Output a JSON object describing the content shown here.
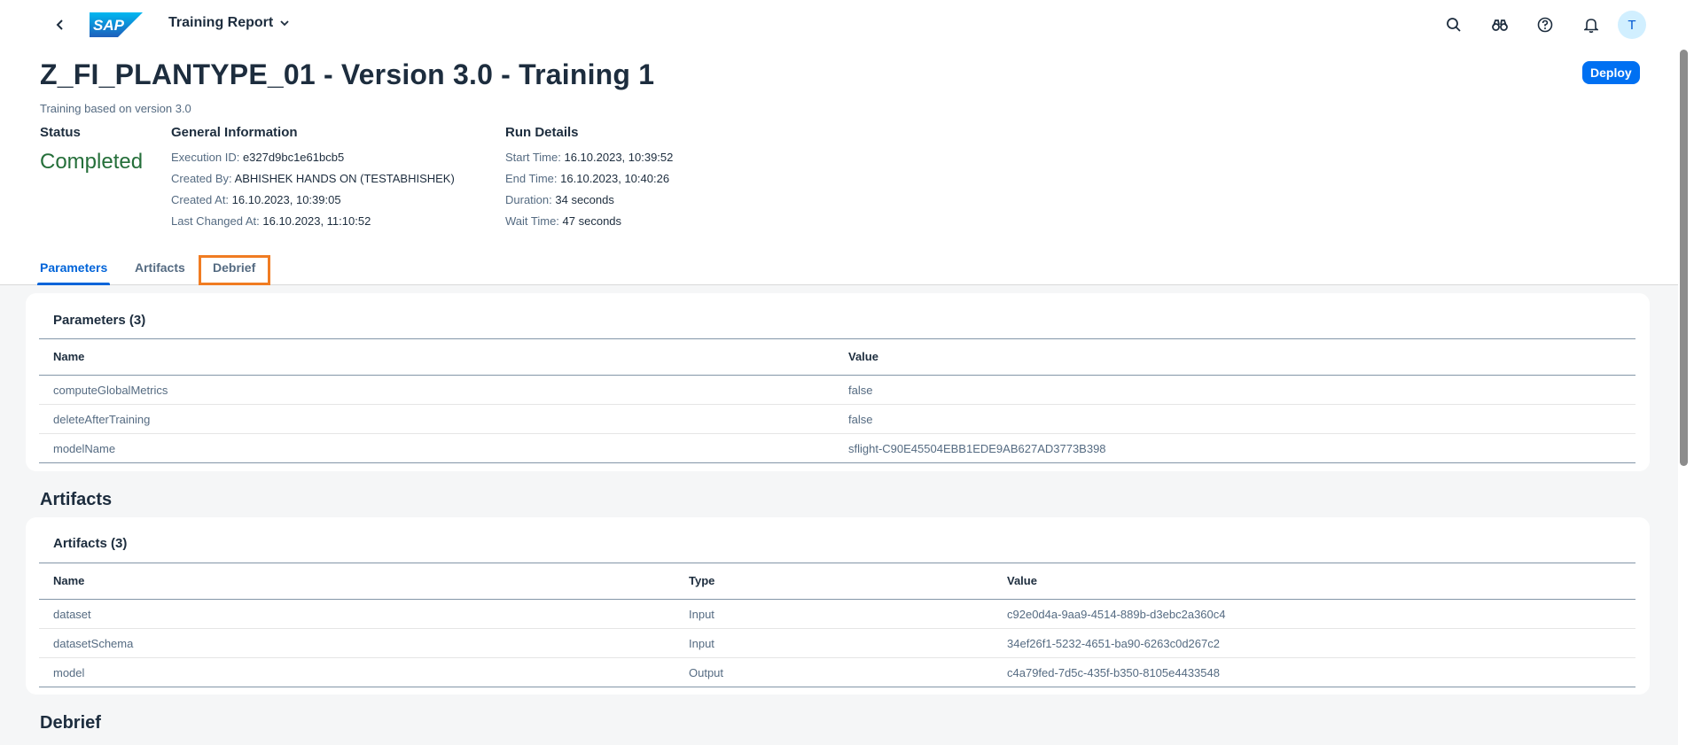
{
  "shell": {
    "app_title": "Training Report",
    "logo_text": "SAP",
    "avatar_initial": "T"
  },
  "header": {
    "title": "Z_FI_PLANTYPE_01 - Version 3.0 - Training 1",
    "subtitle": "Training based on version 3.0",
    "deploy_label": "Deploy",
    "status": {
      "heading": "Status",
      "value": "Completed",
      "color": "#256f3a"
    },
    "general": {
      "heading": "General Information",
      "execution_id_label": "Execution ID:",
      "execution_id": "e327d9bc1e61bcb5",
      "created_by_label": "Created By:",
      "created_by": "ABHISHEK HANDS ON (TESTABHISHEK)",
      "created_at_label": "Created At:",
      "created_at": "16.10.2023, 10:39:05",
      "last_changed_label": "Last Changed At:",
      "last_changed": "16.10.2023, 11:10:52"
    },
    "run": {
      "heading": "Run Details",
      "start_label": "Start Time:",
      "start": "16.10.2023, 10:39:52",
      "end_label": "End Time:",
      "end": "16.10.2023, 10:40:26",
      "duration_label": "Duration:",
      "duration": "34 seconds",
      "wait_label": "Wait Time:",
      "wait": "47 seconds"
    }
  },
  "tabs": [
    {
      "label": "Parameters",
      "active": true
    },
    {
      "label": "Artifacts",
      "active": false
    },
    {
      "label": "Debrief",
      "active": false
    }
  ],
  "parameters": {
    "title": "Parameters (3)",
    "columns": [
      "Name",
      "Value"
    ],
    "rows": [
      {
        "name": "computeGlobalMetrics",
        "value": "false"
      },
      {
        "name": "deleteAfterTraining",
        "value": "false"
      },
      {
        "name": "modelName",
        "value": "sflight-C90E45504EBB1EDE9AB627AD3773B398"
      }
    ]
  },
  "artifacts": {
    "section_title": "Artifacts",
    "title": "Artifacts (3)",
    "columns": [
      "Name",
      "Type",
      "Value"
    ],
    "rows": [
      {
        "name": "dataset",
        "type": "Input",
        "value": "c92e0d4a-9aa9-4514-889b-d3ebc2a360c4"
      },
      {
        "name": "datasetSchema",
        "type": "Input",
        "value": "34ef26f1-5232-4651-ba90-6263c0d267c2"
      },
      {
        "name": "model",
        "type": "Output",
        "value": "c4a79fed-7d5c-435f-b350-8105e4433548"
      }
    ]
  },
  "debrief": {
    "section_title": "Debrief"
  },
  "colors": {
    "accent": "#0070f2",
    "highlight": "#f07c22",
    "success": "#256f3a"
  }
}
